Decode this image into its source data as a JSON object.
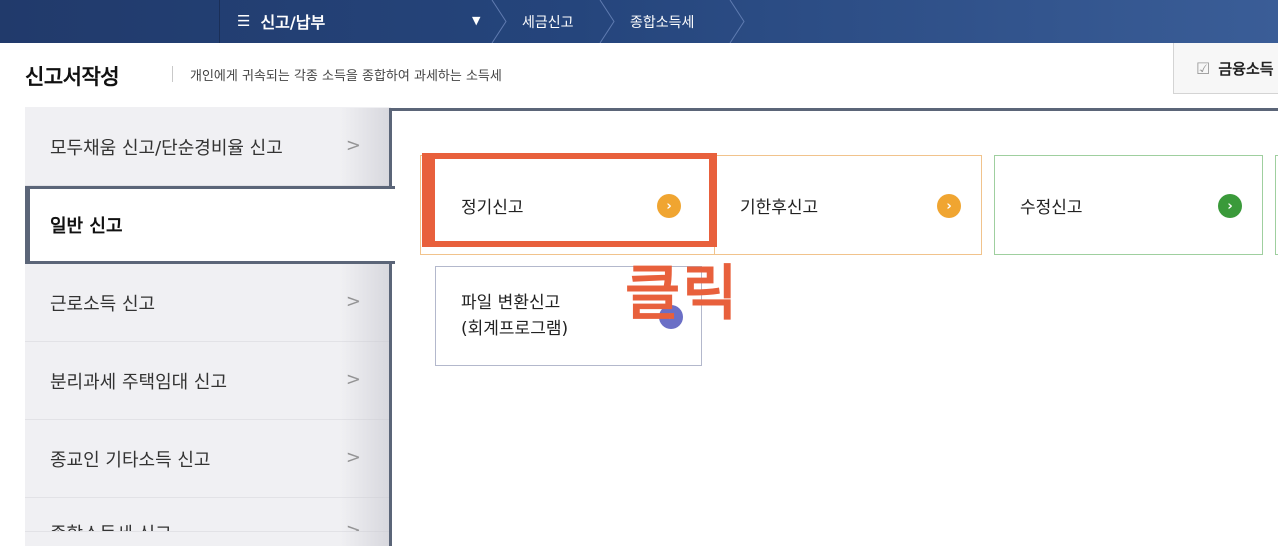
{
  "topnav": {
    "menu_icon": "hamburger-icon",
    "menu_label": "신고/납부",
    "breadcrumbs": [
      "세금신고",
      "종합소득세"
    ]
  },
  "header": {
    "title": "신고서작성",
    "description": "개인에게 귀속되는 각종 소득을 종합하여 과세하는 소득세",
    "financial_button": "금융소득"
  },
  "sidebar": {
    "items": [
      {
        "label": "모두채움 신고/단순경비율 신고"
      },
      {
        "label": "일반 신고",
        "active": true
      },
      {
        "label": "근로소득 신고"
      },
      {
        "label": "분리과세 주택임대 신고"
      },
      {
        "label": "종교인 기타소득 신고"
      },
      {
        "label": "종합소득세 신고"
      }
    ]
  },
  "options": {
    "regular": "정기신고",
    "late": "기한후신고",
    "amend": "수정신고",
    "file_line1": "파일 변환신고",
    "file_line2": "(회계프로그램)"
  },
  "annotation": {
    "click_text": "클릭",
    "color": "#e8603c"
  },
  "colors": {
    "nav_bg": "#25457c",
    "accent_orange": "#f0a531",
    "accent_green": "#3a9a3a",
    "accent_purple": "#6b6fc6"
  }
}
